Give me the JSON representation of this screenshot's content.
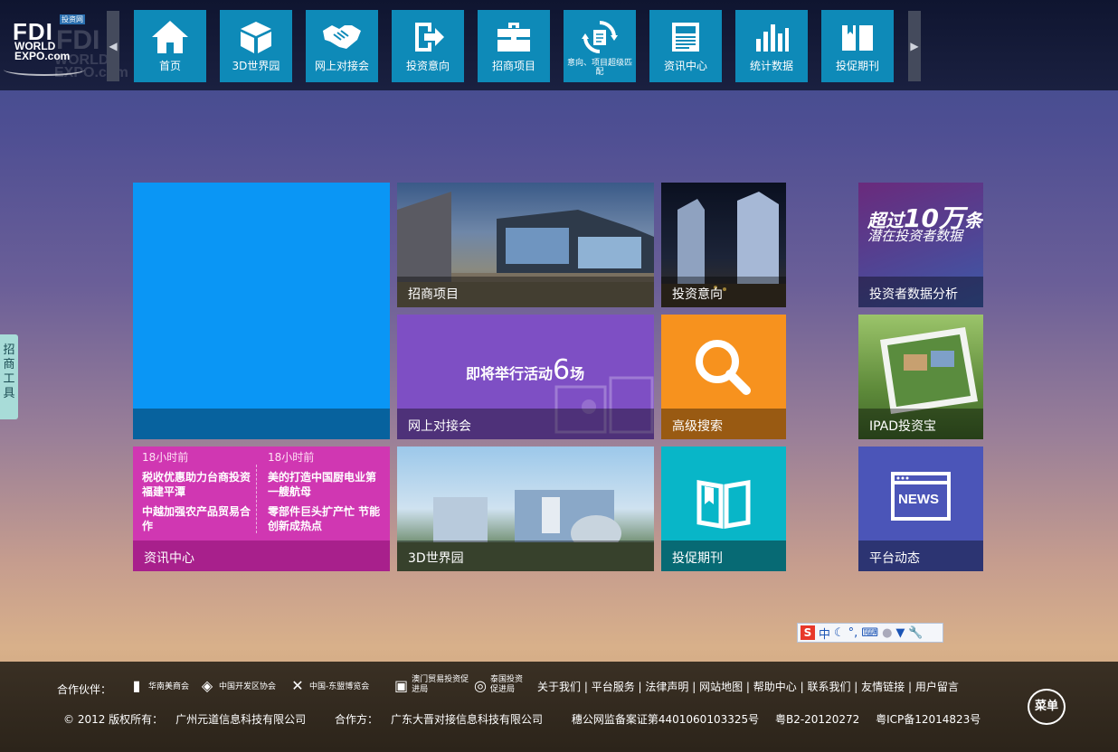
{
  "logo": {
    "tag": "投资网",
    "text1": "FDI",
    "text2": "WORLD",
    "text3": "EXPO.com"
  },
  "nav": {
    "items": [
      {
        "label": "首页",
        "icon": "home-icon"
      },
      {
        "label": "3D世界园",
        "icon": "cube-icon"
      },
      {
        "label": "网上对接会",
        "icon": "handshake-icon"
      },
      {
        "label": "投资意向",
        "icon": "export-icon"
      },
      {
        "label": "招商项目",
        "icon": "briefcase-icon"
      },
      {
        "label": "意向、项目超级匹配",
        "icon": "match-icon"
      },
      {
        "label": "资讯中心",
        "icon": "newspaper-icon"
      },
      {
        "label": "统计数据",
        "icon": "bar-chart-icon"
      },
      {
        "label": "投促期刊",
        "icon": "book-icon"
      }
    ]
  },
  "side_tab": {
    "label": "招商工具"
  },
  "tiles": {
    "zhaoshang": "招商项目",
    "touzi": "投资意向",
    "data": "投资者数据分析",
    "data_line1_a": "超过",
    "data_line1_b": "10万",
    "data_line1_c": "条",
    "data_line2": "潜在投资者数据",
    "meet": "网上对接会",
    "meet_text_a": "即将举行活动",
    "meet_text_b": "6",
    "meet_text_c": "场",
    "search": "高级搜索",
    "ipad": "IPAD投资宝",
    "news": "资讯中心",
    "news_col1": {
      "time": "18小时前",
      "item1": "税收优惠助力台商投资福建平潭",
      "item2": "中越加强农产品贸易合作"
    },
    "news_col2": {
      "time": "18小时前",
      "item1": "美的打造中国厨电业第一艘航母",
      "item2": "零部件巨头扩产忙 节能创新成热点"
    },
    "threed": "3D世界园",
    "mag": "投促期刊",
    "dyn": "平台动态",
    "news_badge": "NEWS"
  },
  "ime": {
    "s": "S",
    "zh": "中"
  },
  "footer": {
    "partner_label": "合作伙伴：",
    "partners": [
      "华南美商会",
      "中国开发区协会",
      "中国-东盟博览会",
      "澳门贸易投资促进局",
      "泰国投资促进局"
    ],
    "links": [
      "关于我们",
      "平台服务",
      "法律声明",
      "网站地图",
      "帮助中心",
      "联系我们",
      "友情链接",
      "用户留言"
    ],
    "copyright": "© 2012 版权所有：",
    "owner": "广州元道信息科技有限公司",
    "partner_co_label": "合作方：",
    "partner_co": "广东大晋对接信息科技有限公司",
    "gongan": "穗公网监备案证第4401060103325号",
    "icp1": "粤B2-20120272",
    "icp2": "粤ICP备12014823号",
    "menu": "菜单"
  }
}
